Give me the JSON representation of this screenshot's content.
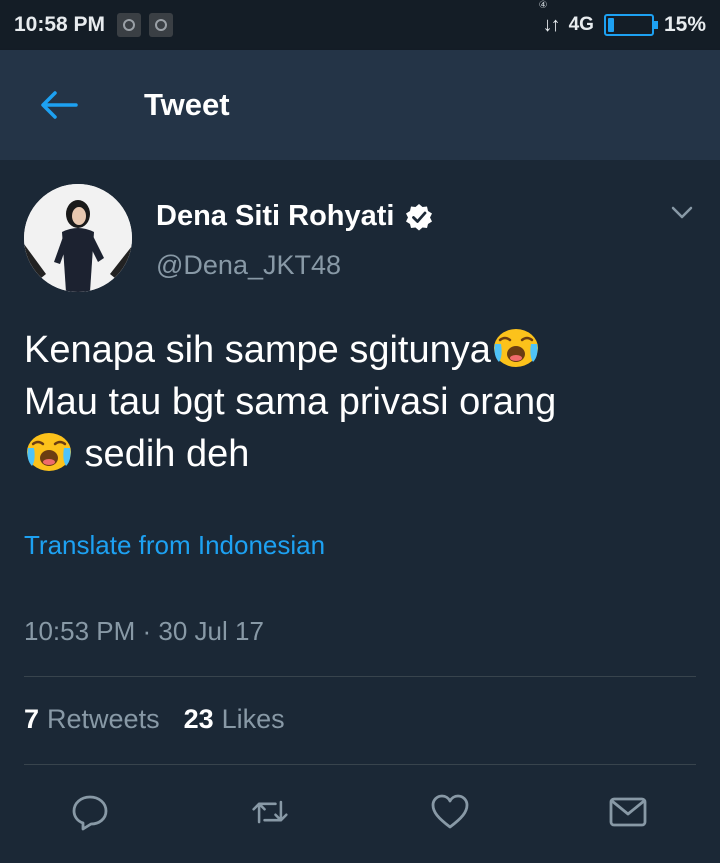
{
  "status_bar": {
    "time": "10:58 PM",
    "notification_icons": [
      "app-notification-icon",
      "app-notification-icon"
    ],
    "network_glyph": "↓↑",
    "network_label": "4G",
    "network_sub": "④",
    "battery_percent_label": "15%",
    "battery_level": 0.15
  },
  "header": {
    "back_icon": "arrow-left-icon",
    "title": "Tweet"
  },
  "tweet": {
    "author": {
      "display_name": "Dena Siti Rohyati",
      "handle": "@Dena_JKT48",
      "verified": true
    },
    "text_line1": "Kenapa sih sampe sgitunya",
    "text_line2": "Mau tau bgt sama privasi orang",
    "text_line3": " sedih deh",
    "emoji": "loudly-crying-face",
    "translate_label": "Translate from Indonesian",
    "timestamp": "10:53 PM · 30 Jul 17",
    "retweets_count": "7",
    "retweets_label": "Retweets",
    "likes_count": "23",
    "likes_label": "Likes"
  },
  "actions": [
    "reply-icon",
    "retweet-icon",
    "like-icon",
    "direct-message-icon"
  ],
  "colors": {
    "accent": "#1da1f2",
    "background": "#141d26",
    "header": "#243447",
    "card": "#1b2836",
    "secondary_text": "#8899a6",
    "divider": "#38444d"
  }
}
